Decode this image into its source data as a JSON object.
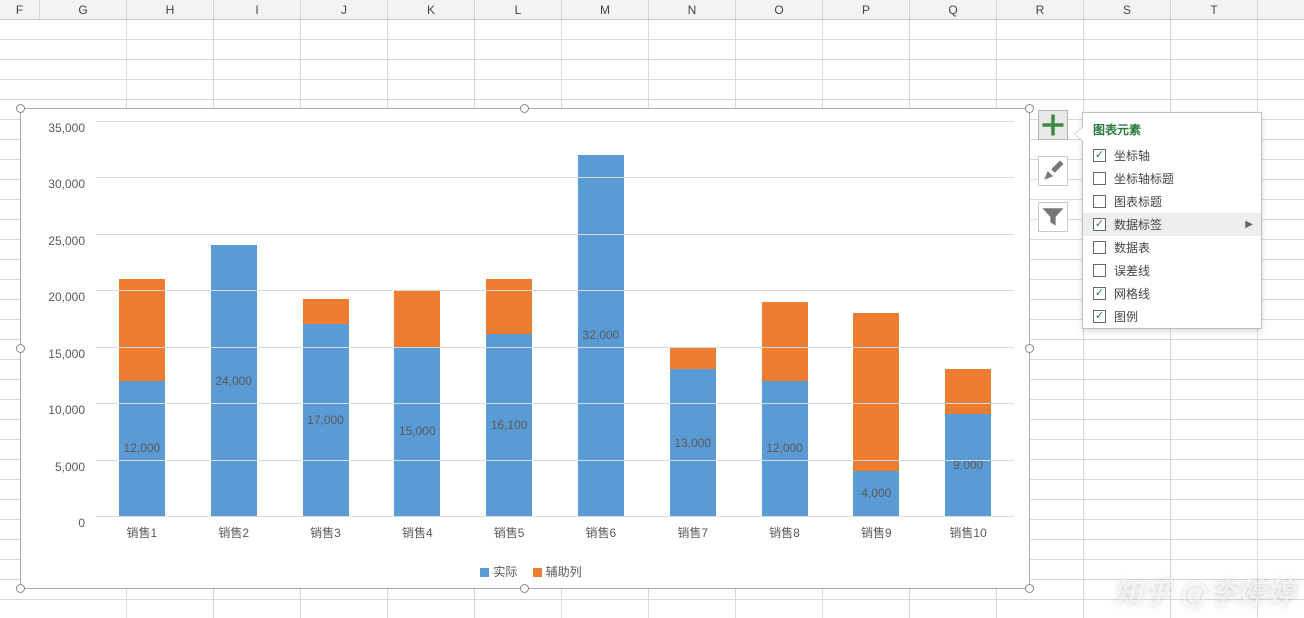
{
  "columns": [
    "F",
    "G",
    "H",
    "I",
    "J",
    "K",
    "L",
    "M",
    "N",
    "O",
    "P",
    "Q",
    "R",
    "S",
    "T"
  ],
  "chart_data": {
    "type": "bar",
    "stacked": true,
    "categories": [
      "销售1",
      "销售2",
      "销售3",
      "销售4",
      "销售5",
      "销售6",
      "销售7",
      "销售8",
      "销售9",
      "销售10"
    ],
    "series": [
      {
        "name": "实际",
        "values": [
          12000,
          24000,
          17000,
          15000,
          16100,
          32000,
          13000,
          12000,
          4000,
          9000
        ],
        "color": "#5b9bd5"
      },
      {
        "name": "辅助列",
        "values": [
          9000,
          0,
          2200,
          5000,
          4900,
          0,
          2000,
          7000,
          14000,
          4000
        ],
        "color": "#ed7d31"
      }
    ],
    "data_labels": [
      "12,000",
      "24,000",
      "17,000",
      "15,000",
      "16,100",
      "32,000",
      "13,000",
      "12,000",
      "4,000",
      "9,000"
    ],
    "ylim": [
      0,
      35000
    ],
    "ytick_step": 5000,
    "yticks": [
      "0",
      "5,000",
      "10,000",
      "15,000",
      "20,000",
      "25,000",
      "30,000",
      "35,000"
    ],
    "xlabel": "",
    "ylabel": "",
    "title": ""
  },
  "panel": {
    "title": "图表元素",
    "items": [
      {
        "label": "坐标轴",
        "checked": true
      },
      {
        "label": "坐标轴标题",
        "checked": false
      },
      {
        "label": "图表标题",
        "checked": false
      },
      {
        "label": "数据标签",
        "checked": true,
        "hover": true,
        "submenu": true
      },
      {
        "label": "数据表",
        "checked": false
      },
      {
        "label": "误差线",
        "checked": false
      },
      {
        "label": "网格线",
        "checked": true
      },
      {
        "label": "图例",
        "checked": true
      }
    ]
  },
  "watermark": "知乎 @李婷婷"
}
